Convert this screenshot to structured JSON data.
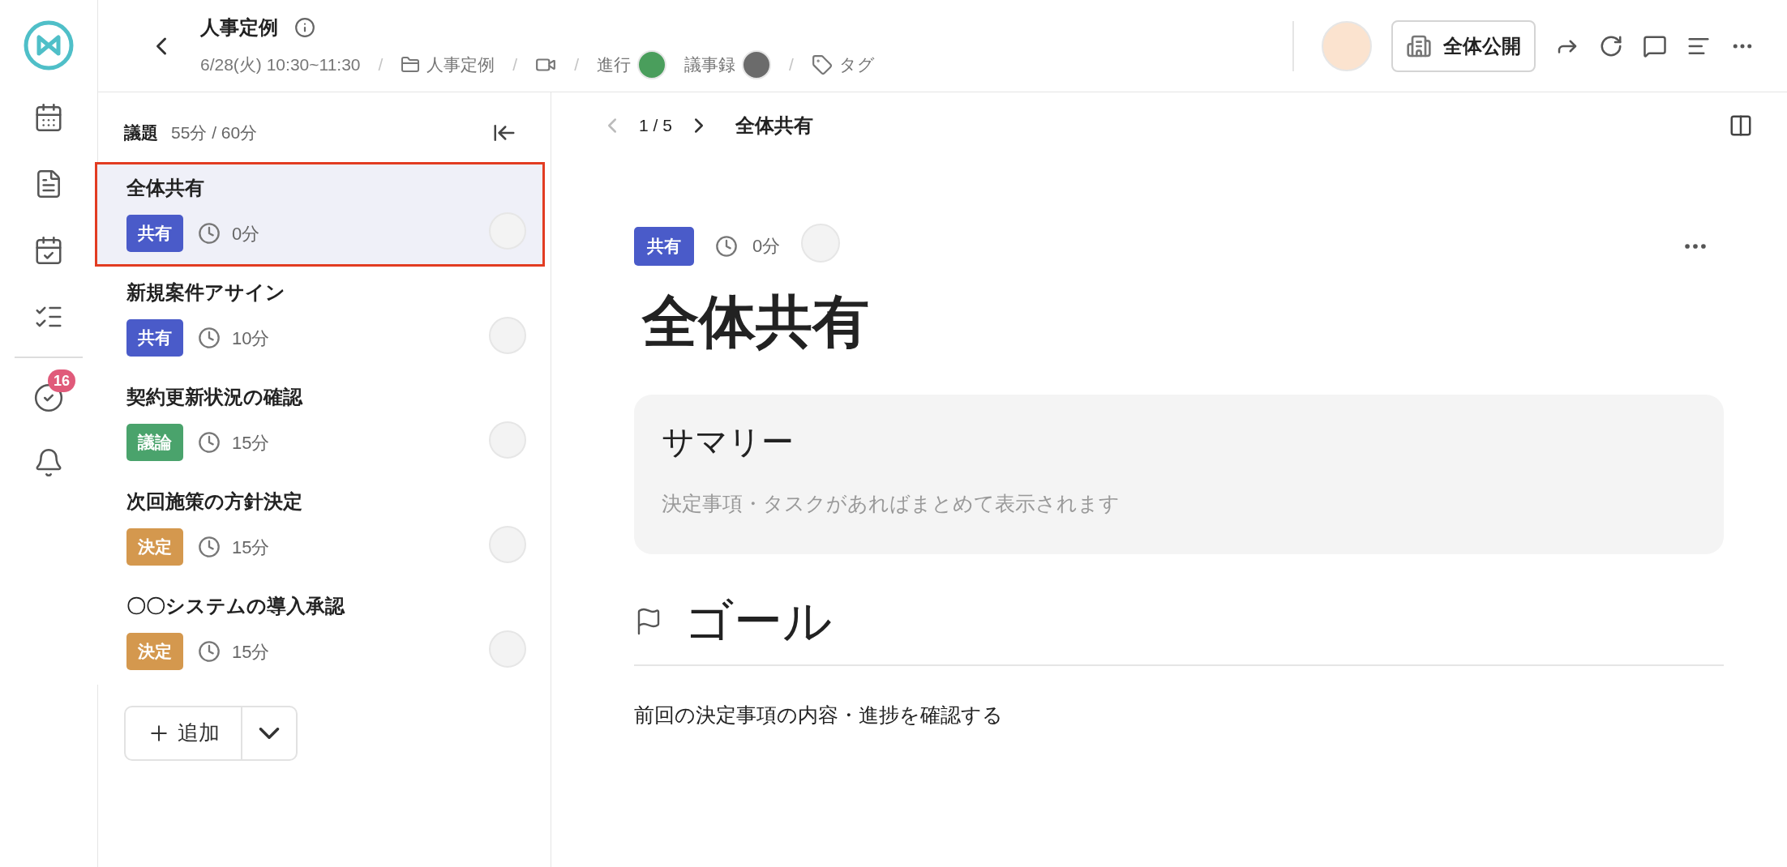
{
  "rail": {
    "badge": "16"
  },
  "header": {
    "title": "人事定例",
    "meta": [
      {
        "kind": "text",
        "text": "6/28(火) 10:30~11:30"
      },
      {
        "kind": "separator",
        "text": "/"
      },
      {
        "kind": "folder",
        "text": "人事定例"
      },
      {
        "kind": "separator",
        "text": "/"
      },
      {
        "kind": "video"
      },
      {
        "kind": "separator",
        "text": "/"
      },
      {
        "kind": "person",
        "text": "進行",
        "color": "#4a9e5c"
      },
      {
        "kind": "person",
        "text": "議事録",
        "color": "#6b6b6b"
      },
      {
        "kind": "separator",
        "text": "/"
      },
      {
        "kind": "tag",
        "text": "タグ"
      }
    ],
    "visibility": "全体公開"
  },
  "agenda": {
    "label": "議題",
    "time": "55分 / 60分",
    "items": [
      {
        "title": "全体共有",
        "tag": {
          "label": "共有",
          "color": "#4a5bc9"
        },
        "duration": "0分",
        "selected": true
      },
      {
        "title": "新規案件アサイン",
        "tag": {
          "label": "共有",
          "color": "#4a5bc9"
        },
        "duration": "10分",
        "selected": false
      },
      {
        "title": "契約更新状況の確認",
        "tag": {
          "label": "議論",
          "color": "#4aa36c"
        },
        "duration": "15分",
        "selected": false
      },
      {
        "title": "次回施策の方針決定",
        "tag": {
          "label": "決定",
          "color": "#d4984e"
        },
        "duration": "15分",
        "selected": false
      },
      {
        "title": "〇〇システムの導入承認",
        "tag": {
          "label": "決定",
          "color": "#d4984e"
        },
        "duration": "15分",
        "selected": false
      }
    ],
    "add_button": "追加"
  },
  "main": {
    "pager": "1 / 5",
    "nav_title": "全体共有",
    "tag": {
      "label": "共有",
      "color": "#4a5bc9"
    },
    "duration": "0分",
    "title": "全体共有",
    "summary": {
      "title": "サマリー",
      "hint": "決定事項・タスクがあればまとめて表示されます"
    },
    "goal": {
      "title": "ゴール",
      "text": "前回の決定事項の内容・進捗を確認する"
    }
  }
}
